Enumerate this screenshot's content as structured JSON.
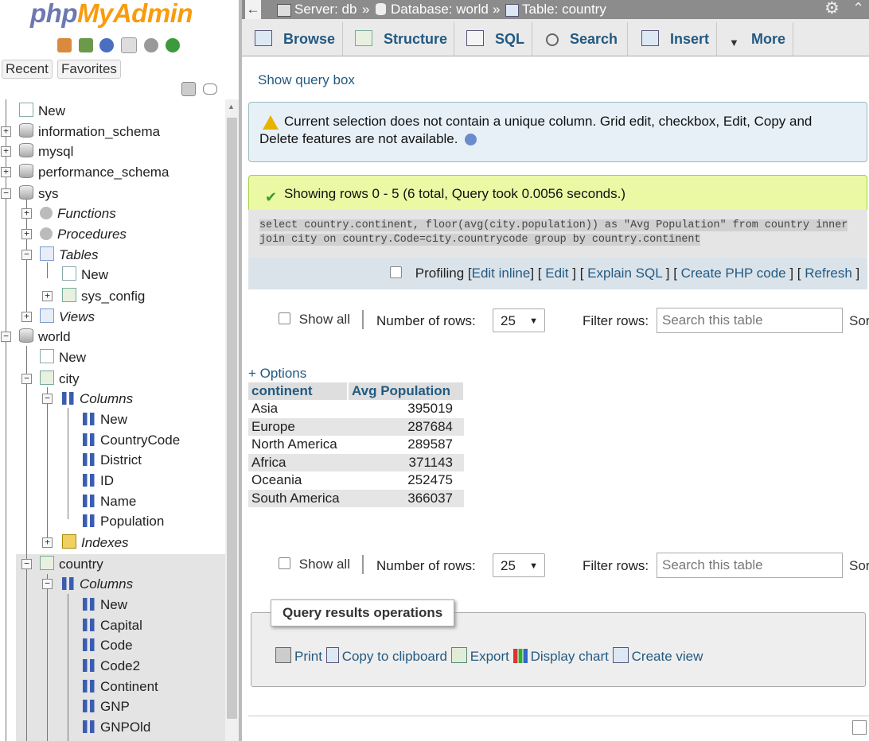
{
  "app": {
    "logo_part1": "php",
    "logo_part2": "MyAdmin"
  },
  "nav": {
    "tabs": [
      "Recent",
      "Favorites"
    ],
    "tree": [
      {
        "label": "New"
      },
      {
        "label": "information_schema"
      },
      {
        "label": "mysql"
      },
      {
        "label": "performance_schema"
      },
      {
        "label": "sys"
      },
      {
        "label": "Functions"
      },
      {
        "label": "Procedures"
      },
      {
        "label": "Tables"
      },
      {
        "label": "New"
      },
      {
        "label": "sys_config"
      },
      {
        "label": "Views"
      },
      {
        "label": "world"
      },
      {
        "label": "New"
      },
      {
        "label": "city"
      },
      {
        "label": "Columns"
      },
      {
        "label": "New"
      },
      {
        "label": "CountryCode"
      },
      {
        "label": "District"
      },
      {
        "label": "ID"
      },
      {
        "label": "Name"
      },
      {
        "label": "Population"
      },
      {
        "label": "Indexes"
      },
      {
        "label": "country"
      },
      {
        "label": "Columns"
      },
      {
        "label": "New"
      },
      {
        "label": "Capital"
      },
      {
        "label": "Code"
      },
      {
        "label": "Code2"
      },
      {
        "label": "Continent"
      },
      {
        "label": "GNP"
      },
      {
        "label": "GNPOld"
      }
    ]
  },
  "breadcrumb": {
    "server": "Server: db",
    "database": "Database: world",
    "table": "Table: country",
    "sep": "»"
  },
  "tabs": [
    "Browse",
    "Structure",
    "SQL",
    "Search",
    "Insert",
    "More"
  ],
  "show_query_box": "Show query box",
  "notice": "Current selection does not contain a unique column. Grid edit, checkbox, Edit, Copy and Delete features are not available.",
  "success": "Showing rows 0 - 5 (6 total, Query took 0.0056 seconds.)",
  "sql": "select country.continent, floor(avg(city.population)) as \"Avg Population\" from country inner join city on country.Code=city.countrycode group by country.continent",
  "profiling": {
    "label": "Profiling",
    "links": [
      "Edit inline",
      "Edit",
      "Explain SQL",
      "Create PHP code",
      "Refresh"
    ]
  },
  "nav_controls": {
    "show_all": "Show all",
    "rows_label": "Number of rows:",
    "rows_value": "25",
    "filter_label": "Filter rows:",
    "filter_placeholder": "Search this table",
    "sort_cut": "Sor"
  },
  "options_link": "+ Options",
  "results": {
    "columns": [
      "continent",
      "Avg Population"
    ],
    "rows": [
      [
        "Asia",
        "395019"
      ],
      [
        "Europe",
        "287684"
      ],
      [
        "North America",
        "289587"
      ],
      [
        "Africa",
        "371143"
      ],
      [
        "Oceania",
        "252475"
      ],
      [
        "South America",
        "366037"
      ]
    ]
  },
  "query_ops": {
    "title": "Query results operations",
    "links": [
      "Print",
      "Copy to clipboard",
      "Export",
      "Display chart",
      "Create view"
    ]
  },
  "colors": {
    "link": "#235a81",
    "success_bg": "#ebf8a4",
    "notice_bg": "#e7f0f7",
    "topbar": "#8c8c8c"
  }
}
